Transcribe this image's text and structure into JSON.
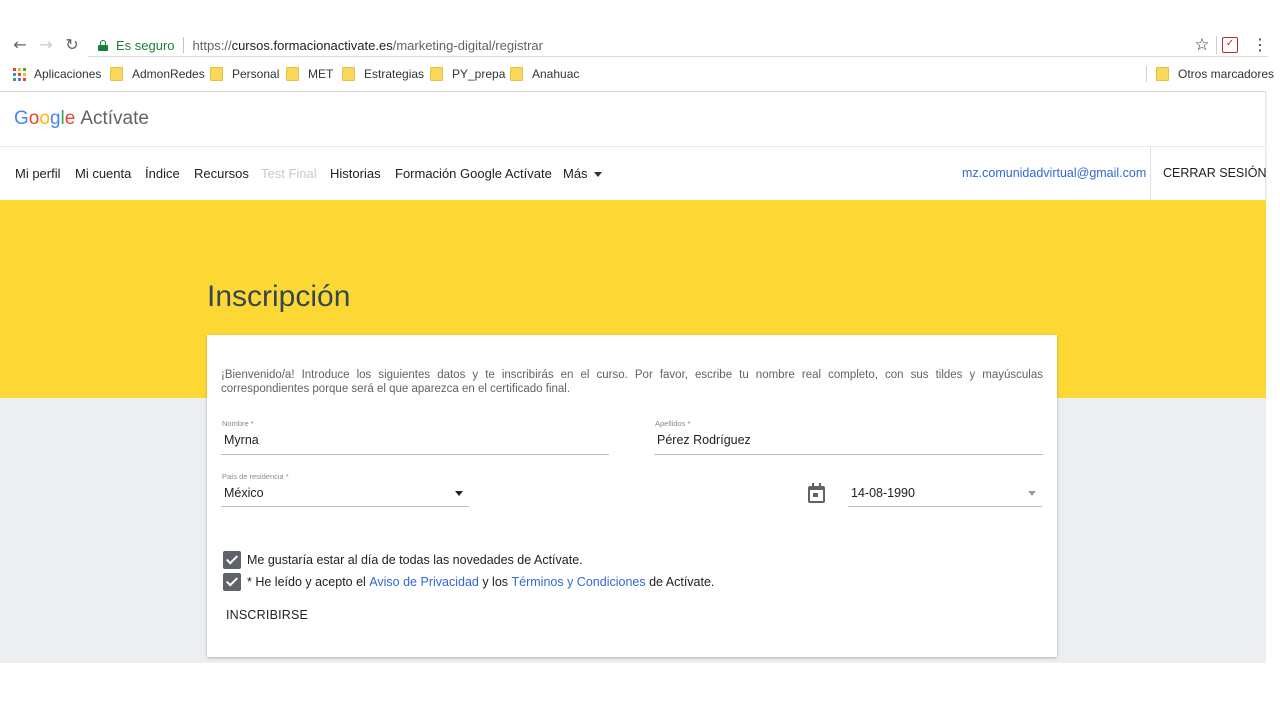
{
  "browser": {
    "secure_label": "Es seguro",
    "url_scheme": "https://",
    "url_host": "cursos.formacionactivate.es",
    "url_path": "/marketing-digital/registrar",
    "bookmarks": {
      "apps": "Aplicaciones",
      "folders": [
        "AdmonRedes",
        "Personal",
        "MET",
        "Estrategias",
        "PY_prepa",
        "Anahuac"
      ],
      "other": "Otros marcadores"
    },
    "icons": [
      "back-icon",
      "forward-icon",
      "reload-icon",
      "lock-icon",
      "star-icon",
      "extension-icon",
      "chrome-menu-icon",
      "apps-icon",
      "folder-icon"
    ]
  },
  "site": {
    "logo": {
      "google": [
        "G",
        "o",
        "o",
        "g",
        "l",
        "e"
      ],
      "product": "Actívate"
    },
    "nav": [
      "Mi perfil",
      "Mi cuenta",
      "Índice",
      "Recursos",
      "Test Final",
      "Historias",
      "Formación Google Actívate",
      "Más"
    ],
    "user_email": "mz.comunidadvirtual@gmail.com",
    "logout": "CERRAR SESIÓN",
    "colors": {
      "hero": "#fdd835",
      "band": "#eceff1",
      "link": "#3367d6",
      "checkbox": "#5f6368"
    }
  },
  "form": {
    "title": "Inscripción",
    "intro": "¡Bienvenido/a! Introduce los siguientes datos y te inscribirás en el curso. Por favor, escribe tu nombre real completo, con sus tildes y mayúsculas correspondientes porque será el que aparezca en el certificado final.",
    "name_label": "Nombre *",
    "name_value": "Myrna",
    "surname_label": "Apellidos *",
    "surname_value": "Pérez Rodríguez",
    "country_label": "País de residencia *",
    "country_value": "México",
    "birthdate_value": "14-08-1990",
    "newsletter_label": "Me gustaría estar al día de todas las novedades de Actívate.",
    "newsletter_checked": true,
    "terms_prefix": "* He leído y acepto el ",
    "terms_privacy_link": "Aviso de Privacidad",
    "terms_middle": " y los ",
    "terms_conditions_link": "Términos y Condiciones",
    "terms_suffix": " de Actívate.",
    "terms_checked": true,
    "submit_label": "INSCRIBIRSE"
  }
}
